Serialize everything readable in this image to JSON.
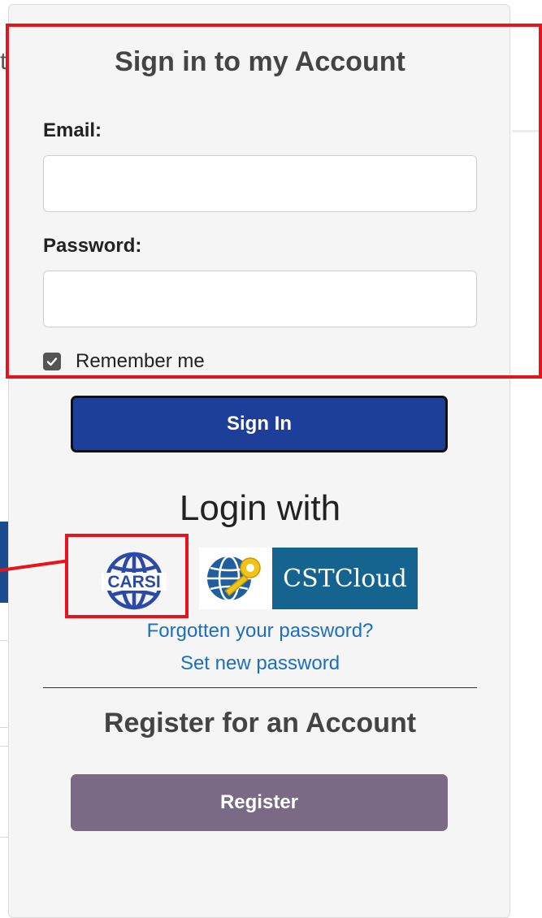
{
  "background": {
    "left_fragment_text": "to"
  },
  "signin": {
    "title": "Sign in to my Account",
    "email_label": "Email:",
    "email_value": "",
    "password_label": "Password:",
    "password_value": "",
    "remember_label": "Remember me",
    "remember_checked": true,
    "button_label": "Sign In"
  },
  "login_with": {
    "heading": "Login with",
    "providers": [
      {
        "name": "CARSI",
        "icon": "carsi-globe-icon"
      },
      {
        "name": "CSTCloud",
        "icon": "globe-key-icon"
      }
    ]
  },
  "links": {
    "forgot_password": "Forgotten your password?",
    "set_new_password": "Set new password"
  },
  "register": {
    "title": "Register for an Account",
    "button_label": "Register"
  },
  "colors": {
    "signin_button": "#1e3f99",
    "register_button": "#7a6a86",
    "link": "#1a6fc4",
    "annotation": "#e8141c",
    "cstcloud_bg": "#15638f"
  }
}
